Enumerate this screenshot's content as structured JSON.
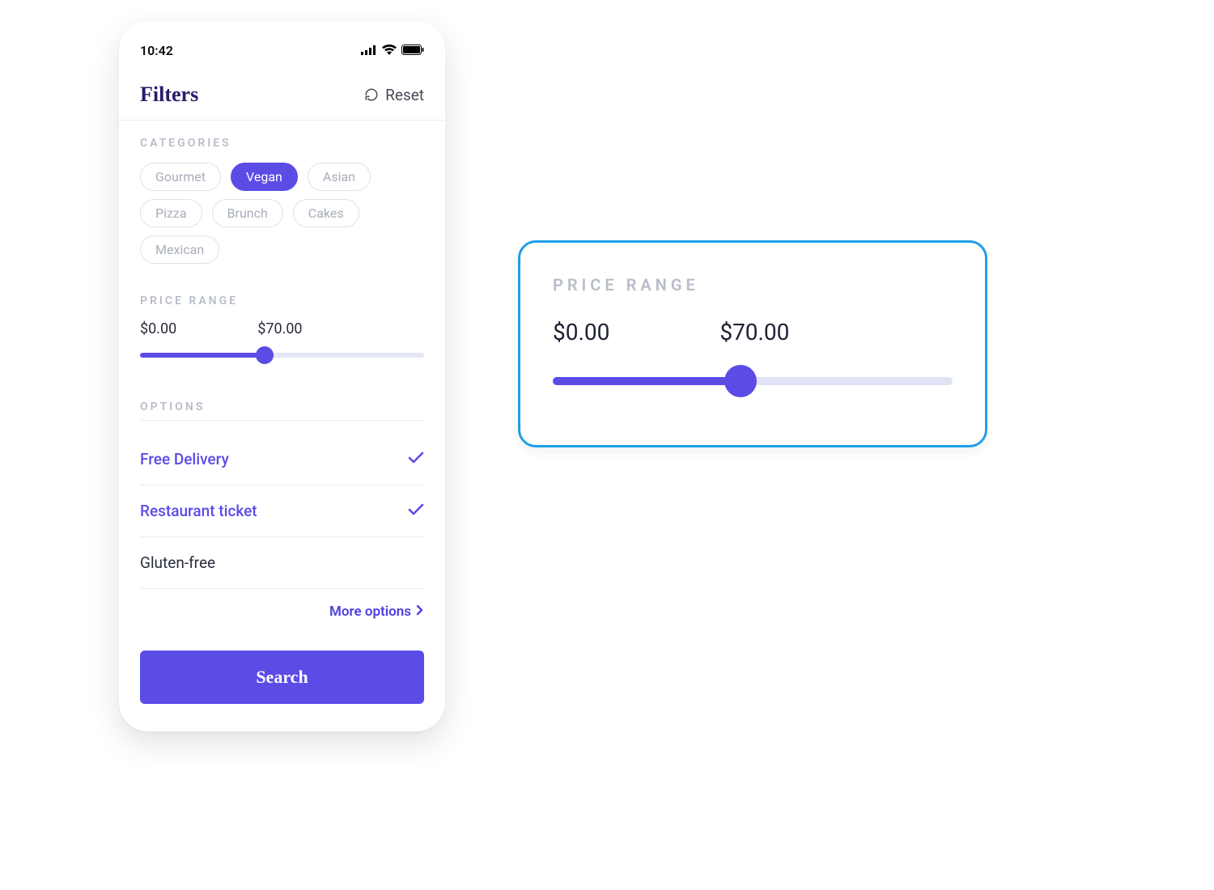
{
  "status": {
    "time": "10:42"
  },
  "header": {
    "title": "Filters",
    "reset": "Reset"
  },
  "categories": {
    "label": "CATEGORIES",
    "items": [
      "Gourmet",
      "Vegan",
      "Asian",
      "Pizza",
      "Brunch",
      "Cakes",
      "Mexican"
    ],
    "active_index": 1
  },
  "price": {
    "label": "PRICE RANGE",
    "min": "$0.00",
    "max": "$70.00",
    "fill_percent": 44
  },
  "options": {
    "label": "OPTIONS",
    "rows": [
      {
        "label": "Free Delivery",
        "checked": true
      },
      {
        "label": "Restaurant ticket",
        "checked": true
      },
      {
        "label": "Gluten-free",
        "checked": false
      }
    ],
    "more": "More options"
  },
  "search_button": "Search",
  "callout": {
    "label": "PRICE RANGE",
    "min": "$0.00",
    "max": "$70.00",
    "fill_percent": 47
  }
}
